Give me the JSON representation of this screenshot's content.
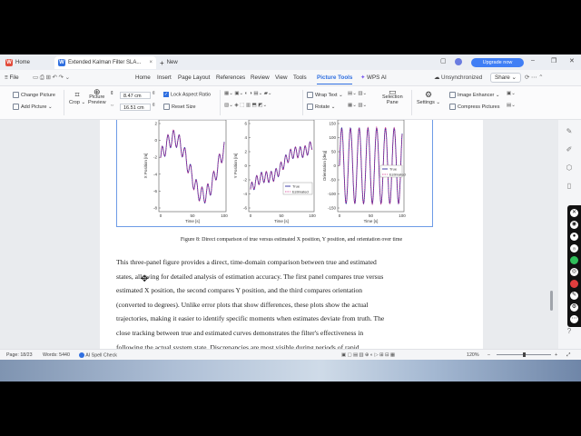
{
  "titlebar": {
    "home_tab": "Home",
    "doc_tab": "Extended Kalman Filter SLA...",
    "new_tab": "New",
    "upgrade": "Upgrade now"
  },
  "menubar": {
    "file": "File",
    "items": [
      "Home",
      "Insert",
      "Page Layout",
      "References",
      "Review",
      "View",
      "Tools",
      "Picture Tools",
      "WPS AI"
    ],
    "unsynced": "Unsynchronized",
    "share": "Share"
  },
  "ribbon": {
    "change_picture": "Change Picture",
    "add_picture": "Add Picture",
    "crop": "Crop",
    "picture_preview_1": "Picture",
    "picture_preview_2": "Preview",
    "height_value": "8.47 cm",
    "width_value": "16.51 cm",
    "lock_aspect": "Lock Aspect Ratio",
    "reset_size": "Reset Size",
    "wrap_text": "Wrap Text",
    "rotate": "Rotate",
    "selection_pane_1": "Selection",
    "selection_pane_2": "Pane",
    "settings": "Settings",
    "image_enhancer": "Image Enhancer",
    "compress_pictures": "Compress Pictures"
  },
  "figure": {
    "caption": "Figure 8: Direct comparison of true versus estimated X position, Y position, and orientation over time",
    "panels": [
      {
        "ylabel": "X Position [m]",
        "xlabel": "Time [s]",
        "yticks": [
          "2",
          "0",
          "-2",
          "-4",
          "-6",
          "-8"
        ],
        "xticks": [
          "0",
          "50",
          "100"
        ]
      },
      {
        "ylabel": "Y Position [m]",
        "xlabel": "Time [s]",
        "yticks": [
          "6",
          "4",
          "2",
          "0",
          "-2",
          "-4",
          "-6"
        ],
        "xticks": [
          "0",
          "50",
          "100"
        ],
        "legend": [
          "True",
          "Estimated"
        ]
      },
      {
        "ylabel": "Orientation [deg]",
        "xlabel": "Time [s]",
        "yticks": [
          "150",
          "100",
          "50",
          "0",
          "-50",
          "-100",
          "-150"
        ],
        "xticks": [
          "0",
          "50",
          "100"
        ],
        "legend": [
          "True",
          "Estimated"
        ]
      }
    ]
  },
  "paragraph": {
    "lines": [
      "This three-panel figure provides a direct, time-domain comparison between true and estimated",
      "states, allowing for detailed analysis of estimation accuracy. The first panel compares true versus",
      "estimated X position, the second compares Y position, and the third compares orientation",
      "(converted to degrees). Unlike error plots that show differences, these plots show the actual",
      "trajectories, making it easier to identify specific moments when estimates deviate from truth. The",
      "close tracking between true and estimated curves demonstrates the filter's effectiveness in",
      "following the actual system state. Discrepancies are most visible during periods of rapid"
    ]
  },
  "statusbar": {
    "page": "Page: 18/23",
    "words": "Words: 5440",
    "spell": "AI Spell Check",
    "zoom": "120%"
  },
  "colors": {
    "accent": "#2f6fe0",
    "true_line": "#2b2b9e",
    "estimated_line": "#d0338a"
  }
}
